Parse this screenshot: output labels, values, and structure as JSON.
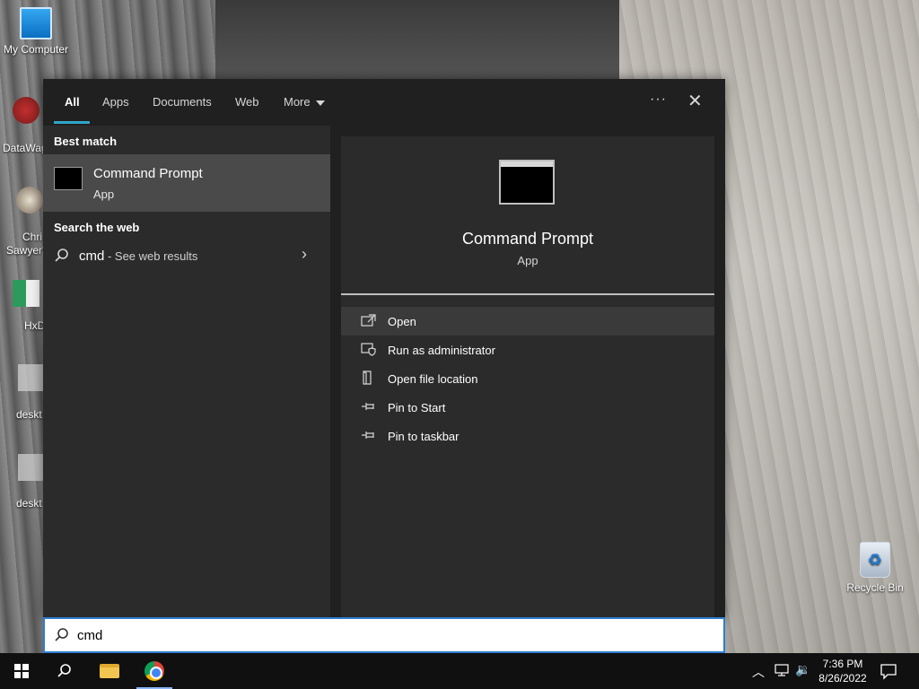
{
  "desktop": {
    "icons": [
      {
        "label": "My Computer"
      },
      {
        "label": "DataWag"
      },
      {
        "label": "Chri"
      },
      {
        "label": "Sawyer'"
      },
      {
        "label": "HxD"
      },
      {
        "label": "deskt"
      },
      {
        "label": "deskt"
      },
      {
        "label": "Recycle Bin"
      }
    ]
  },
  "search_panel": {
    "tabs": [
      {
        "label": "All",
        "active": true
      },
      {
        "label": "Apps"
      },
      {
        "label": "Documents"
      },
      {
        "label": "Web"
      },
      {
        "label": "More"
      }
    ],
    "more_options_icon": "ellipsis-icon",
    "close_icon": "close-icon",
    "best_match_title": "Best match",
    "best_match": {
      "name": "Command Prompt",
      "type": "App"
    },
    "search_web_title": "Search the web",
    "web_result": {
      "query": "cmd",
      "description": " - See web results"
    },
    "detail": {
      "name": "Command Prompt",
      "type": "App",
      "actions": [
        {
          "label": "Open",
          "icon": "open-icon"
        },
        {
          "label": "Run as administrator",
          "icon": "shield-icon"
        },
        {
          "label": "Open file location",
          "icon": "file-location-icon"
        },
        {
          "label": "Pin to Start",
          "icon": "pin-icon"
        },
        {
          "label": "Pin to taskbar",
          "icon": "pin-icon"
        }
      ]
    }
  },
  "search_box": {
    "value": "cmd"
  },
  "taskbar": {
    "time": "7:36 PM",
    "date": "8/26/2022",
    "accent_color": "#8ab4f8"
  },
  "colors": {
    "panel_bg": "#202020",
    "column_bg": "#2b2b2b",
    "selected_bg": "#4a4a4a",
    "tab_accent": "#2fa6c9"
  }
}
